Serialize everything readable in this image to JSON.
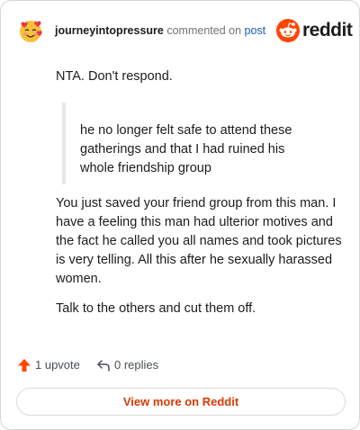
{
  "header": {
    "username": "journeyintopressure",
    "commented_on": "commented on",
    "post_link": "post",
    "brand": "reddit",
    "avatar_icon": "smiling-face-with-hearts-icon"
  },
  "comment": {
    "intro": "NTA. Don't respond.",
    "quote": "he no longer felt safe to attend these gatherings and that I had ruined his whole friendship group",
    "paragraph": "You just saved your friend group from this man. I have a feeling this man had ulterior motives and the fact he called you all names and took pictures is very telling. All this after he sexually harassed women.",
    "closing": "Talk to the others and cut them off."
  },
  "actions": {
    "upvotes": "1 upvote",
    "replies": "0 replies"
  },
  "footer": {
    "view_more": "View more on Reddit"
  },
  "colors": {
    "brand": "#ff4500",
    "link": "#1c5cb8",
    "cta": "#d93a00"
  }
}
